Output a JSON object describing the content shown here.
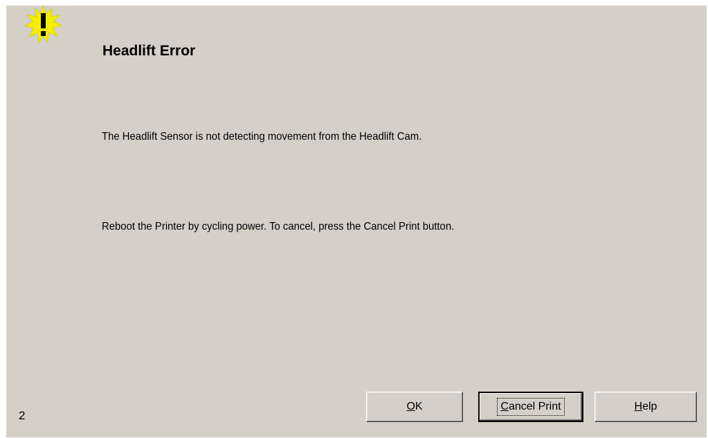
{
  "dialog": {
    "title": "Headlift Error",
    "icon": "warning-icon",
    "message_line1": "The Headlift Sensor is not detecting movement from the Headlift Cam.",
    "message_line2": "Reboot the Printer by cycling power. To cancel, press the Cancel Print button.",
    "error_code": "2"
  },
  "buttons": {
    "ok": {
      "mnemonic": "O",
      "rest": "K"
    },
    "cancel_print": {
      "mnemonic": "C",
      "rest": "ancel Print"
    },
    "help": {
      "mnemonic": "H",
      "rest": "elp"
    }
  },
  "colors": {
    "dialog_background": "#d4d0c8",
    "icon_fill": "#ffff00",
    "text": "#000000"
  }
}
